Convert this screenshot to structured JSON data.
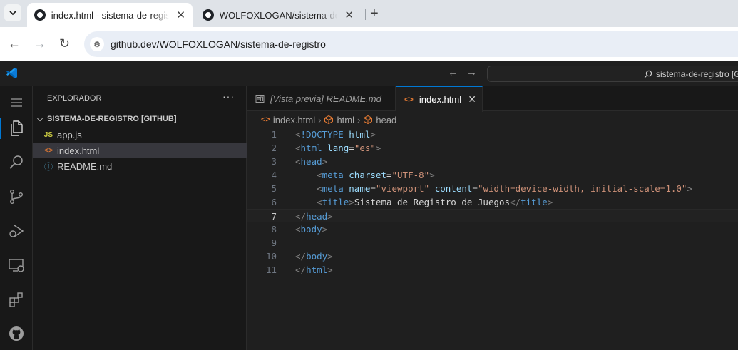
{
  "browser": {
    "tabs": [
      {
        "title": "index.html - sistema-de-registro",
        "active": true
      },
      {
        "title": "WOLFOXLOGAN/sistema-de-registro",
        "active": false
      }
    ],
    "url": "github.dev/WOLFOXLOGAN/sistema-de-registro"
  },
  "vscode": {
    "search_text": "sistema-de-registro [G",
    "sidebar": {
      "title": "EXPLORADOR",
      "more": "···",
      "folder": "SISTEMA-DE-REGISTRO [GITHUB]",
      "files": [
        {
          "name": "app.js",
          "icon": "JS",
          "icon_color": "#cbcb41"
        },
        {
          "name": "index.html",
          "icon": "<>",
          "icon_color": "#e37933",
          "selected": true
        },
        {
          "name": "README.md",
          "icon": "ⓘ",
          "icon_color": "#519aba"
        }
      ]
    },
    "editor": {
      "tabs": [
        {
          "label": "[Vista previa] README.md",
          "active": false
        },
        {
          "label": "index.html",
          "active": true
        }
      ],
      "breadcrumb": [
        "index.html",
        "html",
        "head"
      ],
      "current_line": 7,
      "lines": [
        {
          "n": "1",
          "tokens": [
            [
              "brk",
              "<"
            ],
            [
              "tag",
              "!DOCTYPE"
            ],
            [
              "txt",
              " "
            ],
            [
              "attr",
              "html"
            ],
            [
              "brk",
              ">"
            ]
          ]
        },
        {
          "n": "2",
          "tokens": [
            [
              "brk",
              "<"
            ],
            [
              "tag",
              "html"
            ],
            [
              "txt",
              " "
            ],
            [
              "attr",
              "lang"
            ],
            [
              "eq",
              "="
            ],
            [
              "str",
              "\"es\""
            ],
            [
              "brk",
              ">"
            ]
          ]
        },
        {
          "n": "3",
          "tokens": [
            [
              "brk",
              "<"
            ],
            [
              "tag",
              "head"
            ],
            [
              "brk",
              ">"
            ]
          ]
        },
        {
          "n": "4",
          "tokens": [
            [
              "txt",
              "    "
            ],
            [
              "brk",
              "<"
            ],
            [
              "tag",
              "meta"
            ],
            [
              "txt",
              " "
            ],
            [
              "attr",
              "charset"
            ],
            [
              "eq",
              "="
            ],
            [
              "str",
              "\"UTF-8\""
            ],
            [
              "brk",
              ">"
            ]
          ]
        },
        {
          "n": "5",
          "tokens": [
            [
              "txt",
              "    "
            ],
            [
              "brk",
              "<"
            ],
            [
              "tag",
              "meta"
            ],
            [
              "txt",
              " "
            ],
            [
              "attr",
              "name"
            ],
            [
              "eq",
              "="
            ],
            [
              "str",
              "\"viewport\""
            ],
            [
              "txt",
              " "
            ],
            [
              "attr",
              "content"
            ],
            [
              "eq",
              "="
            ],
            [
              "str",
              "\"width=device-width, initial-scale=1.0\""
            ],
            [
              "brk",
              ">"
            ]
          ]
        },
        {
          "n": "6",
          "tokens": [
            [
              "txt",
              "    "
            ],
            [
              "brk",
              "<"
            ],
            [
              "tag",
              "title"
            ],
            [
              "brk",
              ">"
            ],
            [
              "txt",
              "Sistema de Registro de Juegos"
            ],
            [
              "brk",
              "</"
            ],
            [
              "tag",
              "title"
            ],
            [
              "brk",
              ">"
            ]
          ]
        },
        {
          "n": "7",
          "tokens": [
            [
              "brk",
              "</"
            ],
            [
              "tag",
              "head"
            ],
            [
              "brk",
              ">"
            ]
          ]
        },
        {
          "n": "8",
          "tokens": [
            [
              "brk",
              "<"
            ],
            [
              "tag",
              "body"
            ],
            [
              "brk",
              ">"
            ]
          ]
        },
        {
          "n": "9",
          "tokens": []
        },
        {
          "n": "10",
          "tokens": [
            [
              "brk",
              "</"
            ],
            [
              "tag",
              "body"
            ],
            [
              "brk",
              ">"
            ]
          ]
        },
        {
          "n": "11",
          "tokens": [
            [
              "brk",
              "</"
            ],
            [
              "tag",
              "html"
            ],
            [
              "brk",
              ">"
            ]
          ]
        }
      ]
    }
  }
}
